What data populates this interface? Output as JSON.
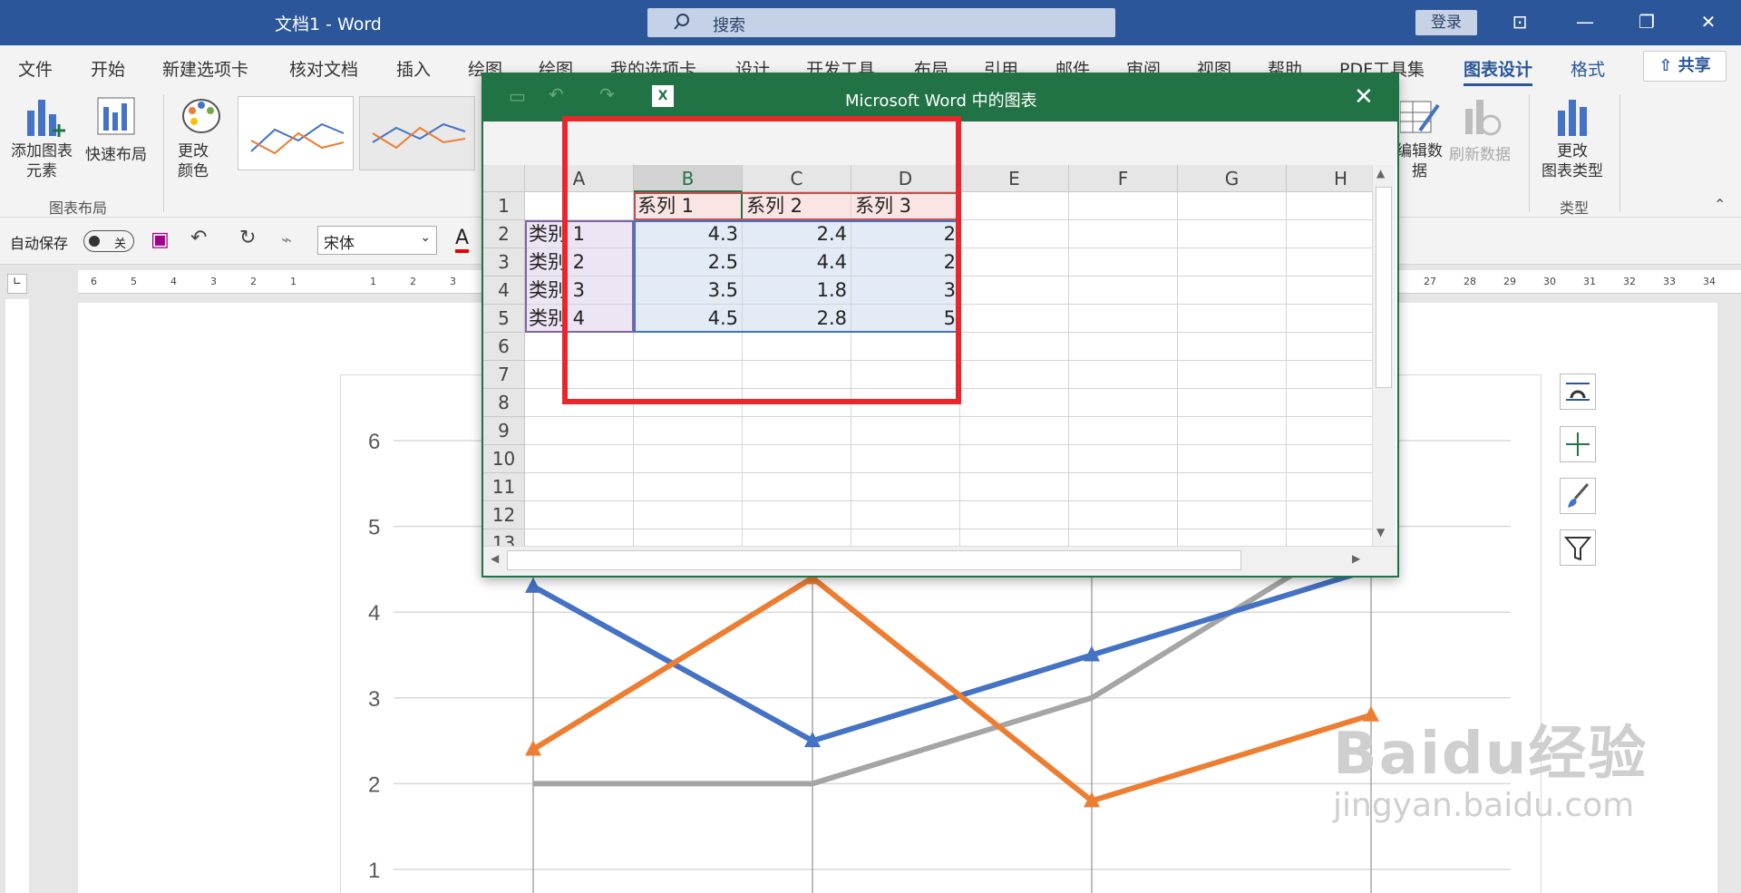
{
  "window": {
    "title": "文档1  -  Word",
    "search_placeholder": "搜索",
    "login": "登录"
  },
  "tabs": [
    "文件",
    "开始",
    "新建选项卡",
    "核对文档",
    "插入",
    "绘图",
    "绘图",
    "我的选项卡",
    "设计",
    "开发工具",
    "布局",
    "引用",
    "邮件",
    "审阅",
    "视图",
    "帮助",
    "PDF工具集",
    "图表设计",
    "格式"
  ],
  "share": "共享",
  "ribbon": {
    "add_element": "添加图表\n元素",
    "quick_layout": "快速布局",
    "change_colors": "更改\n颜色",
    "group_layout": "图表布局",
    "edit_data": "编辑数\n据",
    "refresh_data": "刷新数据",
    "change_type": "更改\n图表类型",
    "group_type": "类型"
  },
  "qat": {
    "autosave": "自动保存",
    "toggle": "关",
    "font": "宋体"
  },
  "excel": {
    "title": "Microsoft Word 中的图表",
    "columns": [
      "A",
      "B",
      "C",
      "D",
      "E",
      "F",
      "G",
      "H"
    ],
    "rows": [
      "1",
      "2",
      "3",
      "4",
      "5",
      "6",
      "7",
      "8",
      "9",
      "10",
      "11",
      "12",
      "13"
    ],
    "header": [
      "",
      "系列 1",
      "系列 2",
      "系列 3"
    ],
    "data": [
      [
        "类别 1",
        "4.3",
        "2.4",
        "2"
      ],
      [
        "类别 2",
        "2.5",
        "4.4",
        "2"
      ],
      [
        "类别 3",
        "3.5",
        "1.8",
        "3"
      ],
      [
        "类别 4",
        "4.5",
        "2.8",
        "5"
      ]
    ]
  },
  "watermark": {
    "big": "Baidu经验",
    "small": "jingyan.baidu.com"
  },
  "colors": {
    "s1": "#4472c4",
    "s2": "#ed7d31",
    "s3": "#a5a5a5",
    "word": "#2b579a",
    "excel": "#217346"
  },
  "chart_data": {
    "type": "line",
    "categories": [
      "类别 1",
      "类别 2",
      "类别 3",
      "类别 4"
    ],
    "series": [
      {
        "name": "系列 1",
        "values": [
          4.3,
          2.5,
          3.5,
          4.5
        ]
      },
      {
        "name": "系列 2",
        "values": [
          2.4,
          4.4,
          1.8,
          2.8
        ]
      },
      {
        "name": "系列 3",
        "values": [
          2,
          2,
          3,
          5
        ]
      }
    ],
    "yticks": [
      "1",
      "2",
      "3",
      "4",
      "5",
      "6"
    ],
    "ylim": [
      1,
      6
    ],
    "grid": true
  }
}
